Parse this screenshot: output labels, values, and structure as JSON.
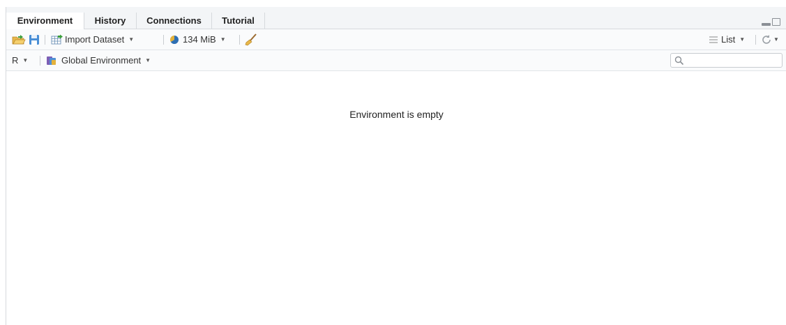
{
  "tabs": [
    {
      "label": "Environment",
      "active": true
    },
    {
      "label": "History",
      "active": false
    },
    {
      "label": "Connections",
      "active": false
    },
    {
      "label": "Tutorial",
      "active": false
    }
  ],
  "toolbar": {
    "import_dataset_label": "Import Dataset",
    "memory_label": "134 MiB",
    "view_mode_label": "List"
  },
  "env_bar": {
    "language_label": "R",
    "environment_label": "Global Environment",
    "search_placeholder": ""
  },
  "main": {
    "empty_message": "Environment is empty"
  },
  "colors": {
    "tabbar_bg": "#f3f5f7",
    "toolbar_bg": "#fafbfc",
    "border": "#d6d9dd"
  },
  "icons": [
    "open-folder-icon",
    "save-icon",
    "import-dataset-icon",
    "memory-pie-icon",
    "broom-icon",
    "list-lines-icon",
    "refresh-icon",
    "r-env-icon",
    "search-icon",
    "minimize-icon",
    "maximize-icon"
  ]
}
